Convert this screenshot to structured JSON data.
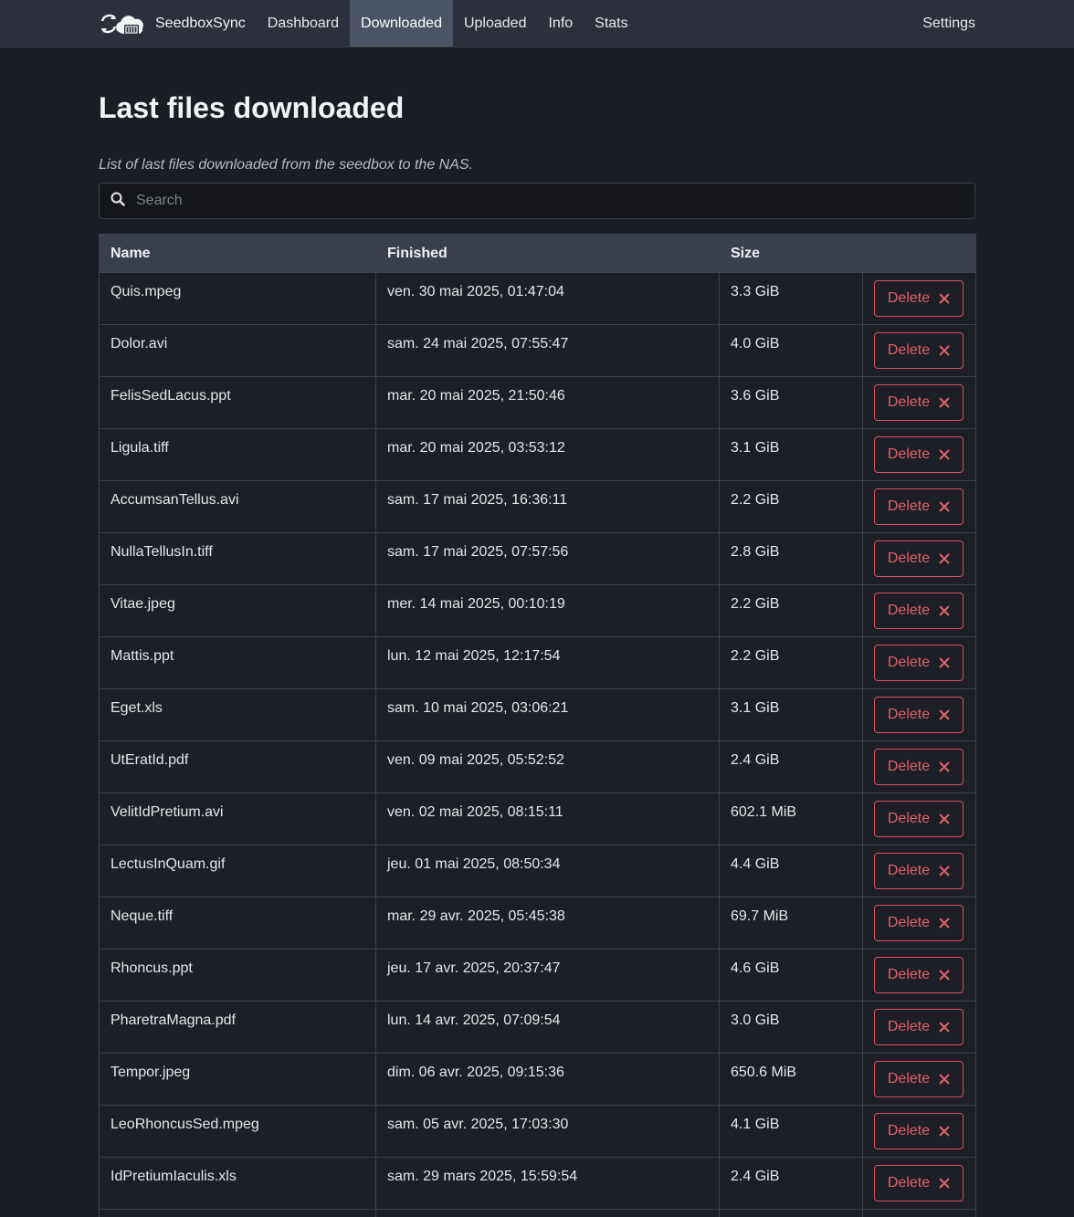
{
  "nav": {
    "brand": "SeedboxSync",
    "logo_icon": "seedbox-sync-logo",
    "items": [
      {
        "label": "Dashboard",
        "active": false
      },
      {
        "label": "Downloaded",
        "active": true
      },
      {
        "label": "Uploaded",
        "active": false
      },
      {
        "label": "Info",
        "active": false
      },
      {
        "label": "Stats",
        "active": false
      }
    ],
    "settings": "Settings"
  },
  "page": {
    "title": "Last files downloaded",
    "subtitle": "List of last files downloaded from the seedbox to the NAS."
  },
  "search": {
    "placeholder": "Search",
    "value": "",
    "icon": "search-icon"
  },
  "table": {
    "columns": [
      "Name",
      "Finished",
      "Size",
      ""
    ],
    "delete_label": "Delete",
    "delete_icon": "close-icon",
    "rows": [
      {
        "name": "Quis.mpeg",
        "finished": "ven. 30 mai 2025, 01:47:04",
        "size": "3.3 GiB"
      },
      {
        "name": "Dolor.avi",
        "finished": "sam. 24 mai 2025, 07:55:47",
        "size": "4.0 GiB"
      },
      {
        "name": "FelisSedLacus.ppt",
        "finished": "mar. 20 mai 2025, 21:50:46",
        "size": "3.6 GiB"
      },
      {
        "name": "Ligula.tiff",
        "finished": "mar. 20 mai 2025, 03:53:12",
        "size": "3.1 GiB"
      },
      {
        "name": "AccumsanTellus.avi",
        "finished": "sam. 17 mai 2025, 16:36:11",
        "size": "2.2 GiB"
      },
      {
        "name": "NullaTellusIn.tiff",
        "finished": "sam. 17 mai 2025, 07:57:56",
        "size": "2.8 GiB"
      },
      {
        "name": "Vitae.jpeg",
        "finished": "mer. 14 mai 2025, 00:10:19",
        "size": "2.2 GiB"
      },
      {
        "name": "Mattis.ppt",
        "finished": "lun. 12 mai 2025, 12:17:54",
        "size": "2.2 GiB"
      },
      {
        "name": "Eget.xls",
        "finished": "sam. 10 mai 2025, 03:06:21",
        "size": "3.1 GiB"
      },
      {
        "name": "UtEratId.pdf",
        "finished": "ven. 09 mai 2025, 05:52:52",
        "size": "2.4 GiB"
      },
      {
        "name": "VelitIdPretium.avi",
        "finished": "ven. 02 mai 2025, 08:15:11",
        "size": "602.1 MiB"
      },
      {
        "name": "LectusInQuam.gif",
        "finished": "jeu. 01 mai 2025, 08:50:34",
        "size": "4.4 GiB"
      },
      {
        "name": "Neque.tiff",
        "finished": "mar. 29 avr. 2025, 05:45:38",
        "size": "69.7 MiB"
      },
      {
        "name": "Rhoncus.ppt",
        "finished": "jeu. 17 avr. 2025, 20:37:47",
        "size": "4.6 GiB"
      },
      {
        "name": "PharetraMagna.pdf",
        "finished": "lun. 14 avr. 2025, 07:09:54",
        "size": "3.0 GiB"
      },
      {
        "name": "Tempor.jpeg",
        "finished": "dim. 06 avr. 2025, 09:15:36",
        "size": "650.6 MiB"
      },
      {
        "name": "LeoRhoncusSed.mpeg",
        "finished": "sam. 05 avr. 2025, 17:03:30",
        "size": "4.1 GiB"
      },
      {
        "name": "IdPretiumIaculis.xls",
        "finished": "sam. 29 mars 2025, 15:59:54",
        "size": "2.4 GiB"
      },
      {
        "name": "",
        "finished": "",
        "size": ""
      }
    ]
  },
  "colors": {
    "navbar_bg": "#2b303b",
    "active_nav_bg": "#4a5466",
    "page_bg": "#1a1d23",
    "danger": "#d9535f"
  }
}
